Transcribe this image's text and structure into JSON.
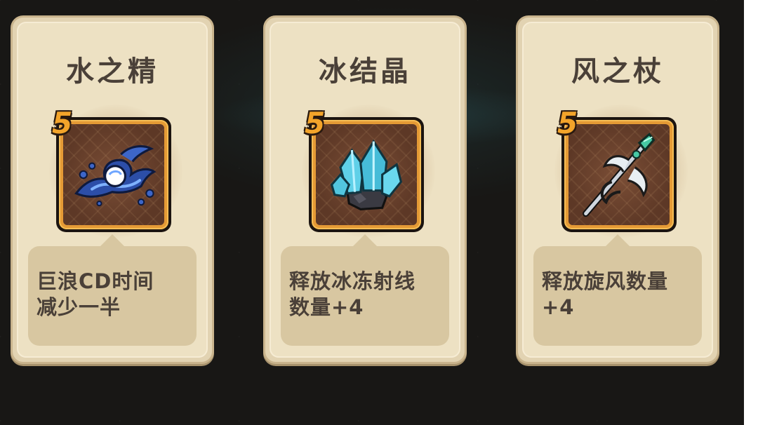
{
  "cards": [
    {
      "title": "水之精",
      "rank": "5",
      "icon": "water-splash-icon",
      "description": "巨浪CD时间\n减少一半"
    },
    {
      "title": "冰结晶",
      "rank": "5",
      "icon": "ice-crystal-icon",
      "description": "释放冰冻射线\n数量+4"
    },
    {
      "title": "风之杖",
      "rank": "5",
      "icon": "wind-staff-icon",
      "description": "释放旋风数量\n+4"
    }
  ],
  "colors": {
    "card": "#ede1c3",
    "frame_gold": "#e59a35",
    "rank_badge": "#f3a42a",
    "text": "#4a4038"
  }
}
